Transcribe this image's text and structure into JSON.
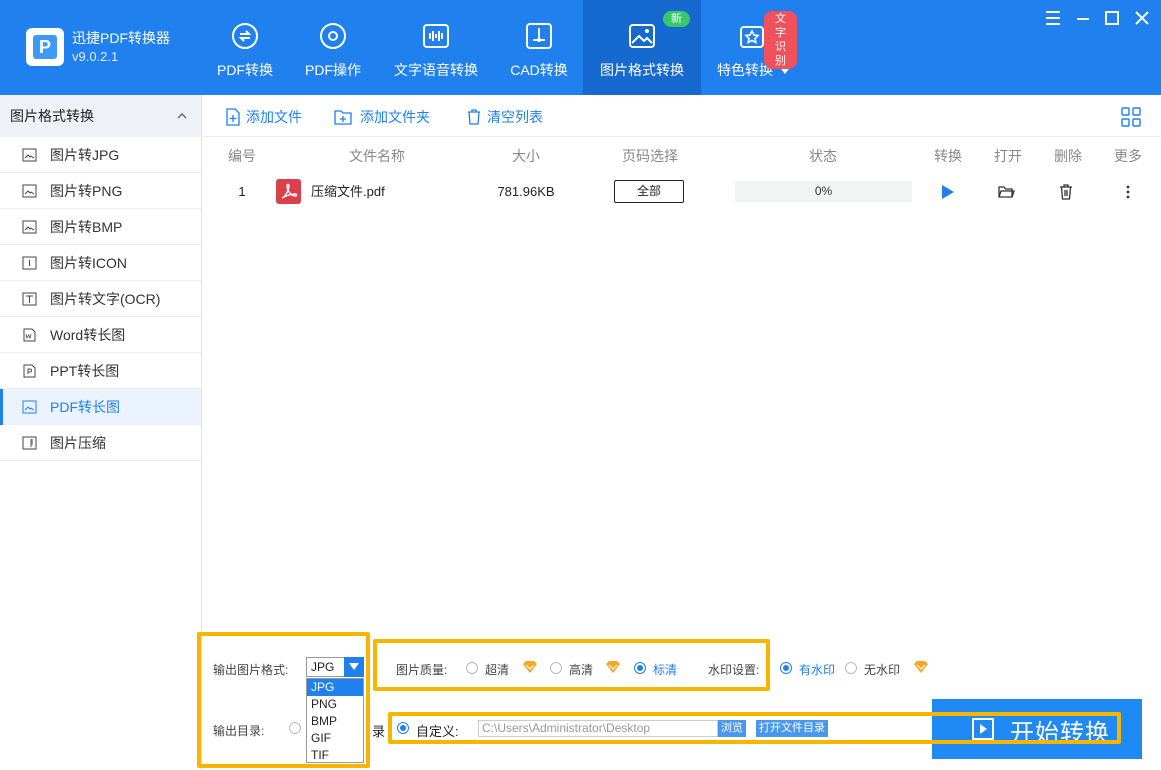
{
  "app": {
    "title": "迅捷PDF转换器",
    "version": "v9.0.2.1"
  },
  "nav": {
    "tabs": [
      {
        "label": "PDF转换"
      },
      {
        "label": "PDF操作"
      },
      {
        "label": "文字语音转换"
      },
      {
        "label": "CAD转换"
      },
      {
        "label": "图片格式转换",
        "badge": "新",
        "active": true
      },
      {
        "label": "特色转换",
        "badge": "文字识别"
      }
    ]
  },
  "sidebar": {
    "header": "图片格式转换",
    "items": [
      {
        "label": "图片转JPG"
      },
      {
        "label": "图片转PNG"
      },
      {
        "label": "图片转BMP"
      },
      {
        "label": "图片转ICON"
      },
      {
        "label": "图片转文字(OCR)"
      },
      {
        "label": "Word转长图"
      },
      {
        "label": "PPT转长图"
      },
      {
        "label": "PDF转长图",
        "active": true
      },
      {
        "label": "图片压缩"
      }
    ]
  },
  "toolbar": {
    "add_file": "添加文件",
    "add_folder": "添加文件夹",
    "clear_list": "清空列表"
  },
  "table": {
    "headers": {
      "index": "编号",
      "name": "文件名称",
      "size": "大小",
      "pages": "页码选择",
      "status": "状态",
      "convert": "转换",
      "open": "打开",
      "delete": "删除",
      "more": "更多"
    },
    "rows": [
      {
        "index": "1",
        "name": "压缩文件.pdf",
        "size": "781.96KB",
        "pages": "全部",
        "progress": "0%",
        "progress_value": 0
      }
    ]
  },
  "bottom": {
    "format_label": "输出图片格式:",
    "format_value": "JPG",
    "format_options": [
      "JPG",
      "PNG",
      "BMP",
      "GIF",
      "TIF"
    ],
    "quality_label": "图片质量:",
    "quality_options": [
      "超清",
      "高清",
      "标清"
    ],
    "quality_selected": "标清",
    "watermark_label": "水印设置:",
    "watermark_options": [
      "有水印",
      "无水印"
    ],
    "watermark_selected": "有水印",
    "output_label": "输出目录:",
    "original_dir_fragment": "录",
    "custom_label": "自定义:",
    "path": "C:\\Users\\Administrator\\Desktop",
    "browse": "浏览",
    "open_dir": "打开文件目录",
    "start": "开始转换"
  },
  "colors": {
    "brand": "#1f80ee",
    "highlight": "#f7b500",
    "vip": "#f5a623"
  }
}
